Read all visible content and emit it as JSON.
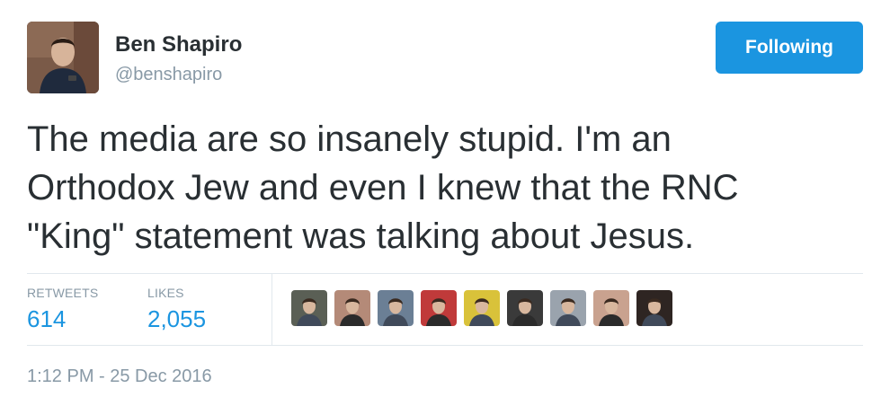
{
  "author": {
    "name": "Ben Shapiro",
    "handle": "@benshapiro"
  },
  "follow_button": {
    "label": "Following"
  },
  "tweet": {
    "lines": [
      "The media are so insanely stupid. I'm an",
      "Orthodox Jew and even I knew that the RNC",
      "\"King\" statement was talking about Jesus."
    ]
  },
  "stats": {
    "retweets_label": "RETWEETS",
    "retweets_value": "614",
    "likes_label": "LIKES",
    "likes_value": "2,055"
  },
  "likers": [
    {
      "icon": "liker-avatar-icon",
      "bg": "#5a5f55"
    },
    {
      "icon": "liker-avatar-icon",
      "bg": "#b48a78"
    },
    {
      "icon": "liker-avatar-icon",
      "bg": "#6b7f95"
    },
    {
      "icon": "liker-avatar-icon",
      "bg": "#c03a3a"
    },
    {
      "icon": "liker-avatar-icon",
      "bg": "#d9c23a"
    },
    {
      "icon": "liker-avatar-icon",
      "bg": "#3a3a3a"
    },
    {
      "icon": "liker-avatar-icon",
      "bg": "#9aa3ad"
    },
    {
      "icon": "liker-avatar-icon",
      "bg": "#c9a28f"
    },
    {
      "icon": "liker-avatar-icon",
      "bg": "#2e2522"
    }
  ],
  "timestamp": "1:12 PM - 25 Dec 2016"
}
